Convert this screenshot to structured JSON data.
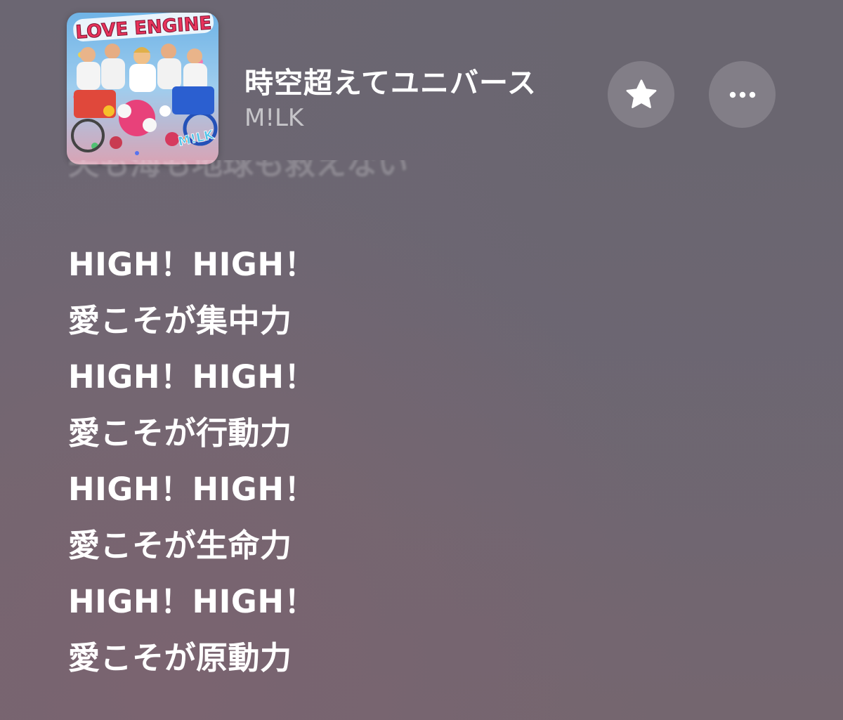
{
  "now_playing": {
    "title": "時空超えてユニバース",
    "artist": "M!LK",
    "album_art": {
      "logo_text": "LOVE ENGINE",
      "badge_text": "M!LK"
    }
  },
  "controls": {
    "favorite_icon": "star-icon",
    "more_icon": "ellipsis-icon"
  },
  "lyrics": {
    "previous_line": "失も海も地球も救えない",
    "lines": [
      "HIGH！HIGH！",
      "愛こそが集中力",
      "HIGH！HIGH！",
      "愛こそが行動力",
      "HIGH！HIGH！",
      "愛こそが生命力",
      "HIGH！HIGH！",
      "愛こそが原動力"
    ]
  },
  "colors": {
    "text": "#ffffff",
    "subtext": "rgba(255,255,255,0.62)",
    "background": "#6e6773"
  }
}
